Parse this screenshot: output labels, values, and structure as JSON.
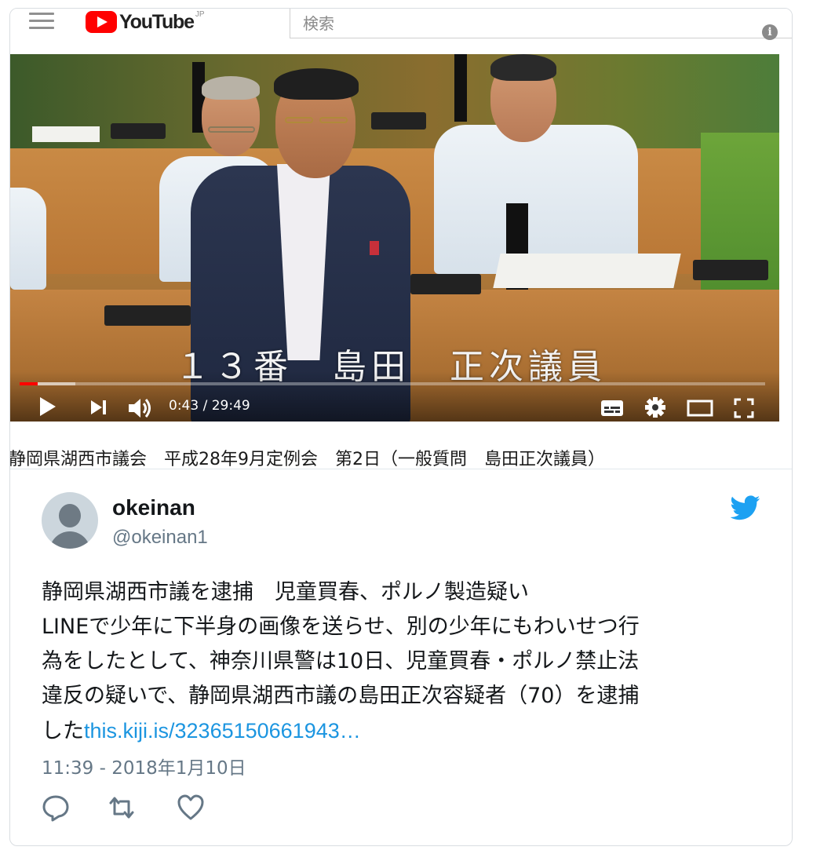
{
  "youtube": {
    "logo_text": "YouTube",
    "region": "JP",
    "search_placeholder": "検索",
    "info_icon": "info-icon"
  },
  "video": {
    "caption": "１３番　島田　正次議員",
    "current_time": "0:43",
    "duration": "29:49",
    "time_display": "0:43 / 29:49",
    "played_fraction": 0.024,
    "loaded_fraction": 0.075,
    "title": "静岡県湖西市議会　平成28年9月定例会　第2日（一般質問　島田正次議員）",
    "controls": [
      "play-icon",
      "next-icon",
      "volume-icon",
      "subtitles-icon",
      "settings-icon",
      "theater-mode-icon",
      "fullscreen-icon"
    ]
  },
  "tweet": {
    "display_name": "okeinan",
    "handle": "@okeinan1",
    "lines": [
      "静岡県湖西市議を逮捕　児童買春、ポルノ製造疑い",
      "LINEで少年に下半身の画像を送らせ、別の少年にもわいせつ行",
      "為をしたとして、神奈川県警は10日、児童買春・ポルノ禁止法",
      "違反の疑いで、静岡県湖西市議の島田正次容疑者（70）を逮捕"
    ],
    "last_line_prefix": "した",
    "link_text": "this.kiji.is/32365150661943…",
    "timestamp": "11:39 - 2018年1月10日",
    "colors": {
      "link": "#1b95e0",
      "bird": "#1da1f2",
      "handle": "#657786"
    }
  }
}
